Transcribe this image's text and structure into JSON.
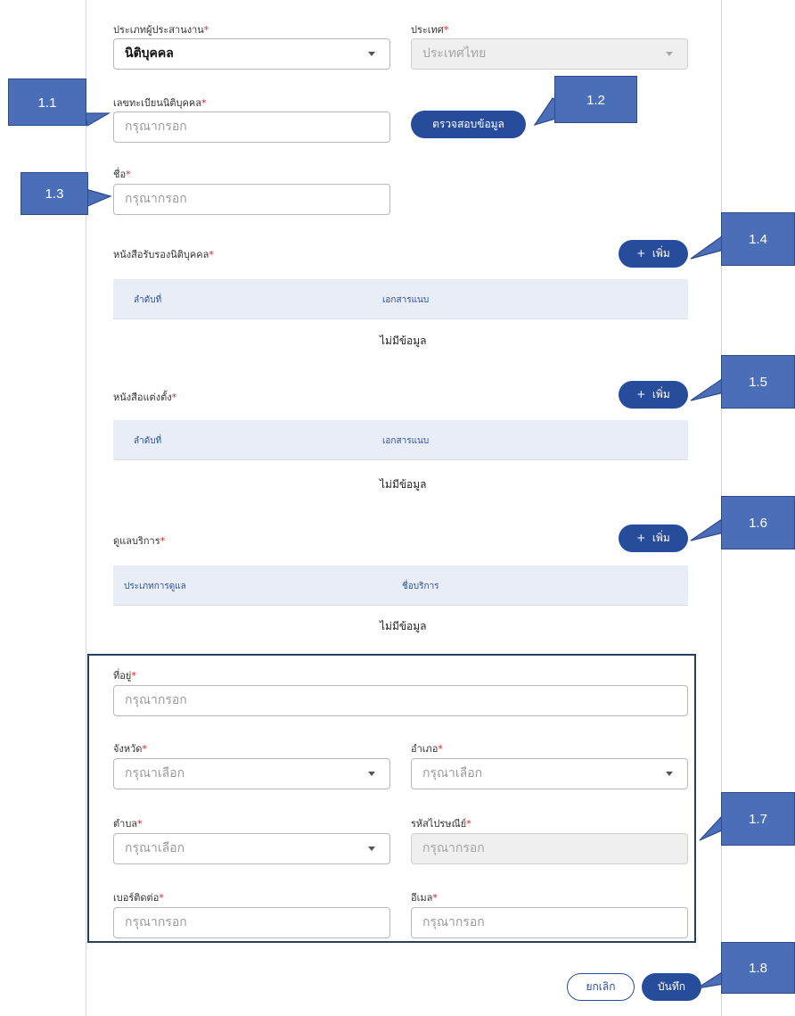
{
  "form": {
    "operator_type": {
      "label": "ประเภทผู้ประสานงาน",
      "value": "นิติบุคคล"
    },
    "country": {
      "label": "ประเทศ",
      "value": "ประเทศไทย"
    },
    "reg_number": {
      "label": "เลขทะเบียนนิติบุคคล",
      "placeholder": "กรุณากรอก"
    },
    "verify_button": "ตรวจสอบข้อมูล",
    "name": {
      "label": "ชื่อ",
      "placeholder": "กรุณากรอก"
    },
    "required_mark": "*",
    "add_label": "เพิ่ม",
    "add_icon": "+"
  },
  "sections": {
    "cert": {
      "title": "หนังสือรับรองนิติบุคคล",
      "columns": [
        "ลำดับที่",
        "เอกสารแนบ"
      ],
      "empty": "ไม่มีข้อมูล"
    },
    "appoint": {
      "title": "หนังสือแต่งตั้ง",
      "columns": [
        "ลำดับที่",
        "เอกสารแนบ"
      ],
      "empty": "ไม่มีข้อมูล"
    },
    "service": {
      "title": "ดูแลบริการ",
      "columns": [
        "ประเภทการดูแล",
        "ชื่อบริการ"
      ],
      "empty": "ไม่มีข้อมูล"
    }
  },
  "address": {
    "address": {
      "label": "ที่อยู่",
      "placeholder": "กรุณากรอก"
    },
    "province": {
      "label": "จังหวัด",
      "placeholder": "กรุณาเลือก"
    },
    "district": {
      "label": "อำเภอ",
      "placeholder": "กรุณาเลือก"
    },
    "subdistrict": {
      "label": "ตำบล",
      "placeholder": "กรุณาเลือก"
    },
    "postcode": {
      "label": "รหัสไปรษณีย์",
      "placeholder": "กรุณากรอก"
    },
    "phone": {
      "label": "เบอร์ติดต่อ",
      "placeholder": "กรุณากรอก"
    },
    "email": {
      "label": "อีเมล",
      "placeholder": "กรุณากรอก"
    }
  },
  "footer": {
    "cancel": "ยกเลิก",
    "save": "บันทึก"
  },
  "callouts": [
    "1.1",
    "1.2",
    "1.3",
    "1.4",
    "1.5",
    "1.6",
    "1.7",
    "1.8"
  ],
  "colors": {
    "primary": "#274c9c",
    "callout": "#4a6fb8",
    "header_bg": "#e9eef6",
    "required": "#e02020"
  }
}
